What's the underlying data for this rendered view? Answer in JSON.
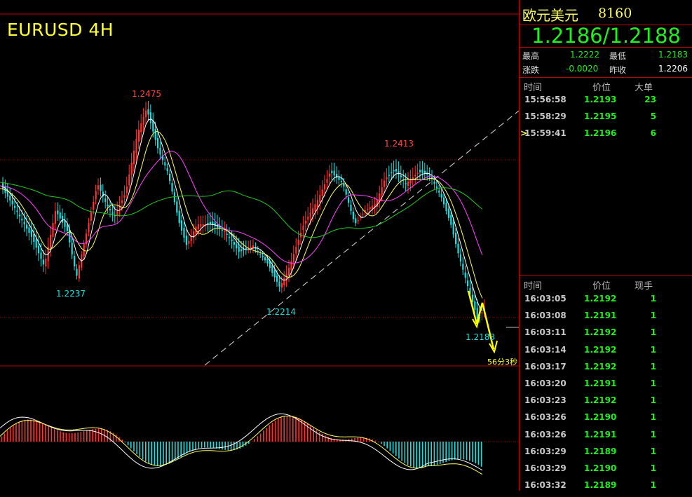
{
  "chart": {
    "title": "EURUSD 4H",
    "peaks": [
      {
        "label": "1.2475",
        "color": "red"
      },
      {
        "label": "1.2413",
        "color": "red"
      },
      {
        "label": "1.2237",
        "color": "cyan"
      },
      {
        "label": "1.2214",
        "color": "cyan"
      },
      {
        "label": "1.2183",
        "color": "cyan"
      }
    ],
    "countdown": "56分3秒",
    "colors": {
      "up": "#ff3333",
      "down": "#22dddd",
      "ma_short": "#ffffff",
      "ma_mid": "#ffff66",
      "ma_long": "#ff44ff",
      "ma_longest": "#22cc22",
      "arrow": "#ffff00"
    }
  },
  "quote": {
    "name": "欧元美元",
    "code": "8160",
    "bid_ask": "1.2186/1.2188",
    "high_label": "最高",
    "high_value": "1.2222",
    "low_label": "最低",
    "low_value": "1.2183",
    "change_label": "涨跌",
    "change_value": "-0.0020",
    "prev_close_label": "昨收",
    "prev_close_value": "1.2206"
  },
  "big_orders": {
    "headers": [
      "时间",
      "价位",
      "大单"
    ],
    "rows": [
      {
        "time": "15:56:58",
        "price": "1.2193",
        "vol": "23"
      },
      {
        "time": "15:58:29",
        "price": "1.2195",
        "vol": "5"
      },
      {
        "time": "15:59:41",
        "price": "1.2196",
        "vol": "6",
        "marker": ">"
      }
    ]
  },
  "ticks": {
    "headers": [
      "时间",
      "价位",
      "现手"
    ],
    "rows": [
      {
        "time": "16:03:05",
        "price": "1.2192",
        "vol": "1"
      },
      {
        "time": "16:03:08",
        "price": "1.2191",
        "vol": "1"
      },
      {
        "time": "16:03:11",
        "price": "1.2192",
        "vol": "1"
      },
      {
        "time": "16:03:14",
        "price": "1.2192",
        "vol": "1"
      },
      {
        "time": "16:03:17",
        "price": "1.2192",
        "vol": "1"
      },
      {
        "time": "16:03:20",
        "price": "1.2191",
        "vol": "1"
      },
      {
        "time": "16:03:23",
        "price": "1.2192",
        "vol": "1"
      },
      {
        "time": "16:03:26",
        "price": "1.2190",
        "vol": "1"
      },
      {
        "time": "16:03:26",
        "price": "1.2191",
        "vol": "1"
      },
      {
        "time": "16:03:29",
        "price": "1.2189",
        "vol": "1"
      },
      {
        "time": "16:03:29",
        "price": "1.2190",
        "vol": "1"
      },
      {
        "time": "16:03:32",
        "price": "1.2189",
        "vol": "1"
      }
    ]
  }
}
